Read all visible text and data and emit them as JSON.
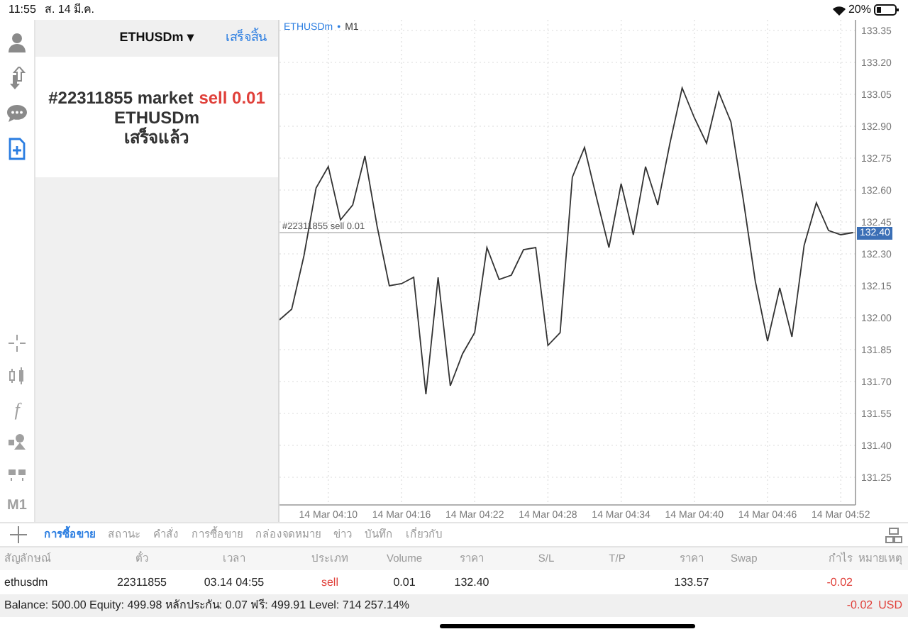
{
  "status_bar": {
    "time": "11:55",
    "date": "ส. 14 มี.ค.",
    "battery": "20%"
  },
  "sidebar_top": [
    {
      "kind": "account",
      "selected": false
    },
    {
      "kind": "trade",
      "selected": false
    },
    {
      "kind": "chat",
      "selected": false
    },
    {
      "kind": "new-order",
      "selected": true
    }
  ],
  "sidebar_tools": [
    {
      "kind": "crosshair"
    },
    {
      "kind": "candles"
    },
    {
      "kind": "text",
      "label": "f"
    },
    {
      "kind": "objects"
    },
    {
      "kind": "chart-mode"
    },
    {
      "kind": "text",
      "label": "M1"
    }
  ],
  "order_panel": {
    "symbol": "ETHUSDm",
    "dropdown_glyph": "▾",
    "done_button": "เสร็จสิ้น",
    "message_prefix": "#22311855 market",
    "message_action": "sell 0.01",
    "message_symbol": "ETHUSDm",
    "message_status": "เสร็จแล้ว"
  },
  "chart": {
    "symbol": "ETHUSDm",
    "separator": "•",
    "period": "M1",
    "price_tag": "132.40",
    "chart_data": {
      "type": "line",
      "categories": [
        null,
        null,
        null,
        null,
        "14 Mar 04:10",
        null,
        null,
        null,
        null,
        null,
        "14 Mar 04:16",
        null,
        null,
        null,
        null,
        null,
        "14 Mar 04:22",
        null,
        null,
        null,
        null,
        null,
        "14 Mar 04:28",
        null,
        null,
        null,
        null,
        null,
        "14 Mar 04:34",
        null,
        null,
        null,
        null,
        null,
        "14 Mar 04:40",
        null,
        null,
        null,
        null,
        null,
        "14 Mar 04:46",
        null,
        null,
        null,
        null,
        null,
        "14 Mar 04:52",
        null
      ],
      "values": [
        131.99,
        132.04,
        132.29,
        132.61,
        132.71,
        132.46,
        132.53,
        132.76,
        132.43,
        132.15,
        132.16,
        132.19,
        131.64,
        132.19,
        131.68,
        131.83,
        131.93,
        132.33,
        132.18,
        132.2,
        132.32,
        132.33,
        131.87,
        131.93,
        132.66,
        132.8,
        132.56,
        132.33,
        132.63,
        132.39,
        132.71,
        132.53,
        132.82,
        133.08,
        132.94,
        132.82,
        133.06,
        132.92,
        132.56,
        132.17,
        131.89,
        132.14,
        131.91,
        132.34,
        132.54,
        132.41,
        132.39,
        132.4
      ],
      "ylim": [
        131.12,
        133.4
      ],
      "yticks": [
        {
          "value": 133.35,
          "label": "133.35"
        },
        {
          "value": 133.2,
          "label": "133.20"
        },
        {
          "value": 133.05,
          "label": "133.05"
        },
        {
          "value": 132.9,
          "label": "132.90"
        },
        {
          "value": 132.75,
          "label": "132.75"
        },
        {
          "value": 132.6,
          "label": "132.60"
        },
        {
          "value": 132.45,
          "label": "132.45"
        },
        {
          "value": 132.3,
          "label": "132.30"
        },
        {
          "value": 132.15,
          "label": "132.15"
        },
        {
          "value": 132.0,
          "label": "132.00"
        },
        {
          "value": 131.85,
          "label": "131.85"
        },
        {
          "value": 131.7,
          "label": "131.70"
        },
        {
          "value": 131.55,
          "label": "131.55"
        },
        {
          "value": 131.4,
          "label": "131.40"
        },
        {
          "value": 131.25,
          "label": "131.25"
        }
      ],
      "grid": true,
      "ref_lines": [
        {
          "axis": "y",
          "value": 132.4,
          "label": "#22311855 sell 0.01"
        }
      ]
    }
  },
  "tabs": [
    {
      "label": "การซื้อขาย",
      "selected": true
    },
    {
      "label": "สถานะ",
      "selected": false
    },
    {
      "label": "คำสั่ง",
      "selected": false
    },
    {
      "label": "การซื้อขาย",
      "selected": false
    },
    {
      "label": "กล่องจดหมาย",
      "selected": false
    },
    {
      "label": "ข่าว",
      "selected": false
    },
    {
      "label": "บันทึก",
      "selected": false
    },
    {
      "label": "เกี่ยวกับ",
      "selected": false
    }
  ],
  "table": {
    "columns": [
      "สัญลักษณ์",
      "ตั๋ว",
      "เวลา",
      "ประเภท",
      "Volume",
      "ราคา",
      "S/L",
      "T/P",
      "ราคา",
      "Swap",
      "กำไร",
      "หมายเหตุ"
    ],
    "rows": [
      {
        "cells": [
          "ethusdm",
          "22311855",
          "03.14 04:55",
          "sell",
          "0.01",
          "132.40",
          "",
          "",
          "133.57",
          "",
          "-0.02",
          ""
        ]
      }
    ]
  },
  "summary": {
    "text": "Balance: 500.00 Equity: 499.98 หลักประกัน: 0.07 ฟรี: 499.91 Level: 714 257.14%",
    "profit": "-0.02",
    "currency": "USD"
  }
}
